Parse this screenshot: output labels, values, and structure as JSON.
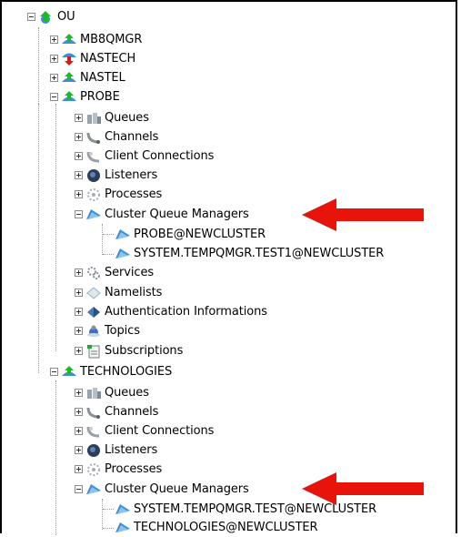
{
  "tree": {
    "root": {
      "label": "OU",
      "icon": "qmgr-up-icon"
    },
    "qmgrs": [
      {
        "label": "MB8QMGR",
        "icon": "qmgr-up-icon"
      },
      {
        "label": "NASTECH",
        "icon": "qmgr-down-icon"
      },
      {
        "label": "NASTEL",
        "icon": "qmgr-up-icon"
      },
      {
        "label": "PROBE",
        "icon": "qmgr-up-icon",
        "children": [
          {
            "label": "Queues",
            "icon": "queues-icon"
          },
          {
            "label": "Channels",
            "icon": "channels-icon"
          },
          {
            "label": "Client Connections",
            "icon": "client-connections-icon"
          },
          {
            "label": "Listeners",
            "icon": "listeners-icon"
          },
          {
            "label": "Processes",
            "icon": "processes-icon"
          },
          {
            "label": "Cluster Queue Managers",
            "icon": "cluster-qmgrs-icon",
            "children": [
              {
                "label": "PROBE@NEWCLUSTER"
              },
              {
                "label": "SYSTEM.TEMPQMGR.TEST1@NEWCLUSTER"
              }
            ]
          },
          {
            "label": "Services",
            "icon": "services-icon"
          },
          {
            "label": "Namelists",
            "icon": "namelists-icon"
          },
          {
            "label": "Authentication Informations",
            "icon": "auth-info-icon"
          },
          {
            "label": "Topics",
            "icon": "topics-icon"
          },
          {
            "label": "Subscriptions",
            "icon": "subscriptions-icon"
          }
        ]
      },
      {
        "label": "TECHNOLOGIES",
        "icon": "qmgr-up-icon",
        "children": [
          {
            "label": "Queues",
            "icon": "queues-icon"
          },
          {
            "label": "Channels",
            "icon": "channels-icon"
          },
          {
            "label": "Client Connections",
            "icon": "client-connections-icon"
          },
          {
            "label": "Listeners",
            "icon": "listeners-icon"
          },
          {
            "label": "Processes",
            "icon": "processes-icon"
          },
          {
            "label": "Cluster Queue Managers",
            "icon": "cluster-qmgrs-icon",
            "children": [
              {
                "label": "SYSTEM.TEMPQMGR.TEST@NEWCLUSTER"
              },
              {
                "label": "TECHNOLOGIES@NEWCLUSTER"
              }
            ]
          }
        ]
      }
    ]
  },
  "annotations": {
    "arrow_color": "#e8140c"
  },
  "colors": {
    "qmgr_up": "#1fb82a",
    "qmgr_down": "#d61818",
    "qmgr_base": "#3a8fd6"
  }
}
